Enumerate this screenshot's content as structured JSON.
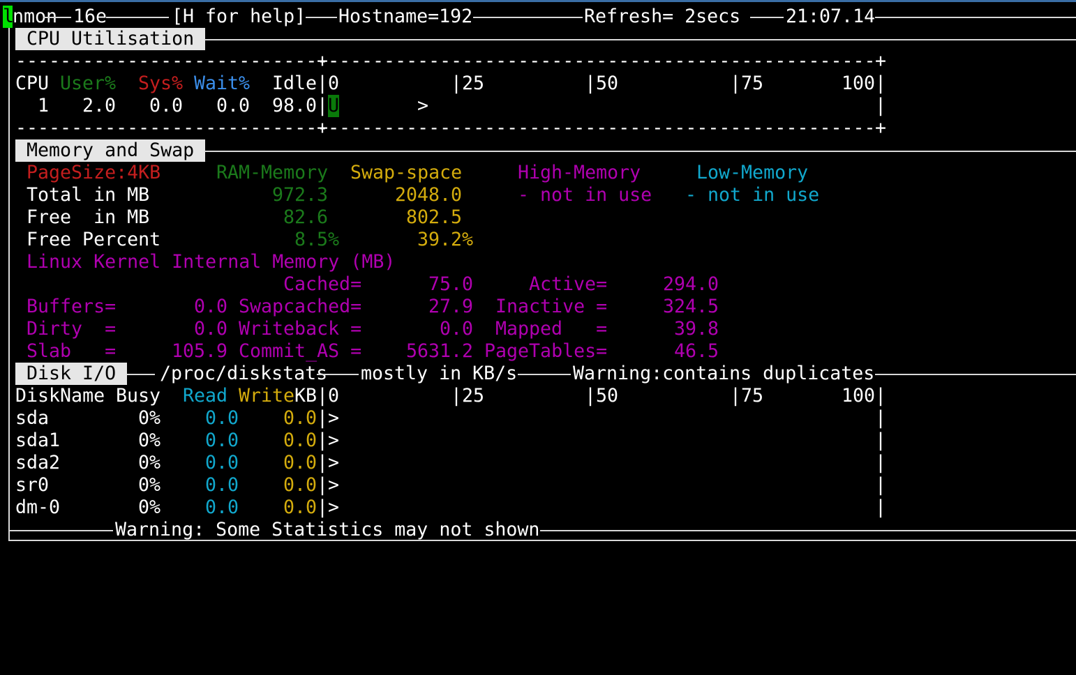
{
  "header": {
    "app": "nmon",
    "app_cursor": "l",
    "app_version": "16e",
    "help": "[H for help]",
    "hostname": "Hostname=192",
    "refresh": "Refresh= 2secs",
    "time": "21:07.14"
  },
  "cpu": {
    "section_label": "CPU Utilisation",
    "dash_line_left": "-----------------------------",
    "dash_line_right": "-------------------------------------------------",
    "columns": {
      "cpu": "CPU",
      "user": "User%",
      "sys": "Sys%",
      "wait": "Wait%",
      "idle": "Idle"
    },
    "scale": {
      "s0": "0",
      "s25": "|25",
      "s50": "|50",
      "s75": "|75",
      "s100": "100|"
    },
    "row": {
      "cpu": "1",
      "user": "2.0",
      "sys": "0.0",
      "wait": "0.0",
      "idle": "98.0",
      "bar": "U",
      "marker": ">"
    }
  },
  "memory": {
    "section_label": "Memory and Swap",
    "page_size": "PageSize:4KB",
    "headers": {
      "ram": "RAM-Memory",
      "swap": "Swap-space",
      "high": "High-Memory",
      "low": "Low-Memory"
    },
    "total": {
      "label": "Total in MB",
      "ram": "972.3",
      "swap": "2048.0",
      "high": "- not in use",
      "low": "- not in use"
    },
    "free": {
      "label": "Free  in MB",
      "ram": "82.6",
      "swap": "802.5"
    },
    "free_pct": {
      "label": "Free Percent",
      "ram": "8.5%",
      "swap": "39.2%"
    },
    "kernel_title": "Linux Kernel Internal Memory (MB)",
    "kernel": {
      "cached_label": "Cached=",
      "cached": "75.0",
      "active_label": "Active=",
      "active": "294.0",
      "buffers_label": "Buffers=",
      "buffers": "0.0",
      "swapcached_label": "Swapcached=",
      "swapcached": "27.9",
      "inactive_label": "Inactive =",
      "inactive": "324.5",
      "dirty_label": "Dirty  =",
      "dirty": "0.0",
      "writeback_label": "Writeback =",
      "writeback": "0.0",
      "mapped_label": "Mapped   =",
      "mapped": "39.8",
      "slab_label": "Slab   =",
      "slab": "105.9",
      "commit_label": "Commit_AS =",
      "commit": "5631.2",
      "pagetables_label": "PageTables=",
      "pagetables": "46.5"
    }
  },
  "disk": {
    "section_label": "Disk I/O",
    "source": "/proc/diskstats",
    "units": "mostly in KB/s",
    "warning": "Warning:contains duplicates",
    "columns": {
      "name": "DiskName",
      "busy": "Busy",
      "read": "Read",
      "write": "Write",
      "kb": "KB"
    },
    "scale": {
      "s0": "0",
      "s25": "|25",
      "s50": "|50",
      "s75": "|75",
      "s100": "100|"
    },
    "rows": [
      {
        "name": "sda",
        "busy": "0%",
        "read": "0.0",
        "write": "0.0",
        "bar": ">"
      },
      {
        "name": "sda1",
        "busy": "0%",
        "read": "0.0",
        "write": "0.0",
        "bar": ">"
      },
      {
        "name": "sda2",
        "busy": "0%",
        "read": "0.0",
        "write": "0.0",
        "bar": ">"
      },
      {
        "name": "sr0",
        "busy": "0%",
        "read": "0.0",
        "write": "0.0",
        "bar": ">"
      },
      {
        "name": "dm-0",
        "busy": "0%",
        "read": "0.0",
        "write": "0.0",
        "bar": ">"
      }
    ]
  },
  "footer": {
    "warning": "Warning: Some Statistics may not shown"
  },
  "colors": {
    "green": "#1b7a1b",
    "red": "#c41e1e",
    "blue": "#3b8eea",
    "yellow": "#d4ac0d",
    "magenta": "#b000b0",
    "cyan": "#11a8cd",
    "cursor": "#00e000"
  }
}
